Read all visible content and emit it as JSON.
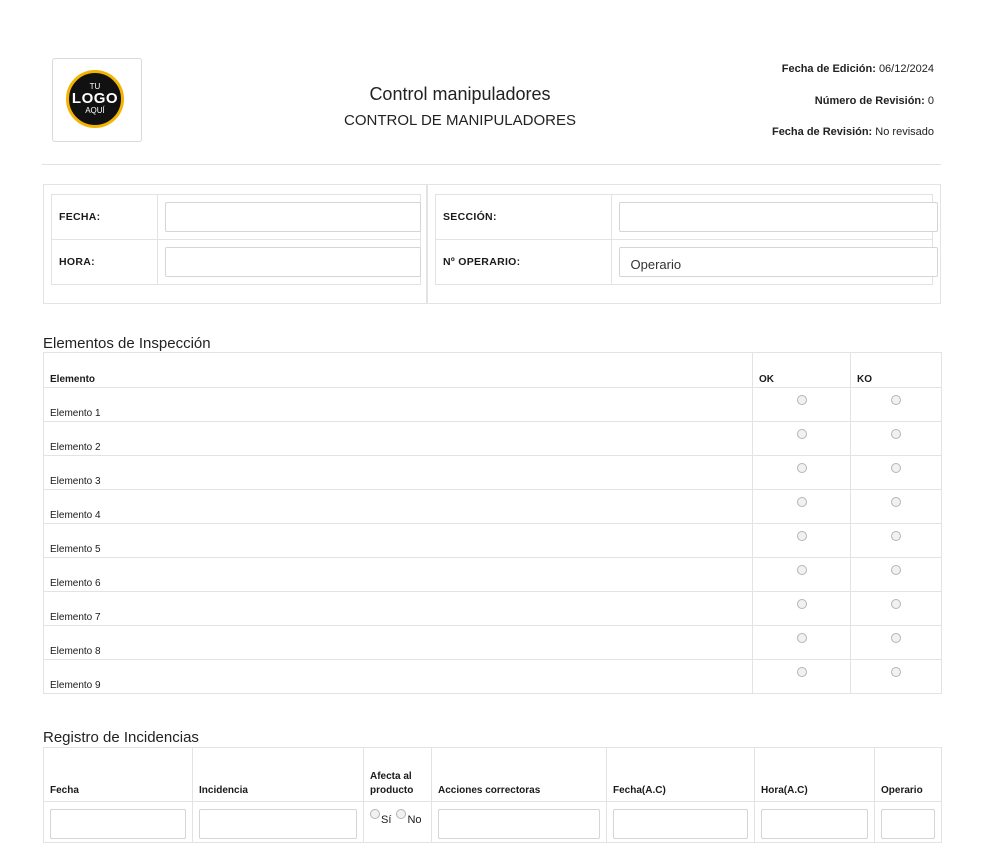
{
  "header": {
    "logo": {
      "line1": "TU",
      "line2": "LOGO",
      "line3": "AQUÍ"
    },
    "title": "Control manipuladores",
    "subtitle": "CONTROL DE MANIPULADORES",
    "meta": [
      {
        "label": "Fecha de Edición:",
        "value": "06/12/2024"
      },
      {
        "label": "Número de Revisión:",
        "value": "0"
      },
      {
        "label": "Fecha de Revisión:",
        "value": "No revisado"
      }
    ]
  },
  "info": {
    "fecha_label": "FECHA:",
    "fecha_value": "",
    "hora_label": "HORA:",
    "hora_value": "",
    "seccion_label": "SECCIÓN:",
    "seccion_value": "",
    "operario_label": "Nº OPERARIO:",
    "operario_value": "Operario"
  },
  "inspection": {
    "title": "Elementos de Inspección",
    "columns": [
      "Elemento",
      "OK",
      "KO"
    ],
    "rows": [
      "Elemento 1",
      "Elemento 2",
      "Elemento 3",
      "Elemento 4",
      "Elemento 5",
      "Elemento 6",
      "Elemento 7",
      "Elemento 8",
      "Elemento 9"
    ]
  },
  "incidents": {
    "title": "Registro de Incidencias",
    "columns": [
      "Fecha",
      "Incidencia",
      "Afecta al producto",
      "Acciones correctoras",
      "Fecha(A.C)",
      "Hora(A.C)",
      "Operario"
    ],
    "yes_label": "Sí",
    "no_label": "No"
  },
  "colors": {
    "logo_ring": "#f2b400",
    "border": "#e3e3e3"
  }
}
